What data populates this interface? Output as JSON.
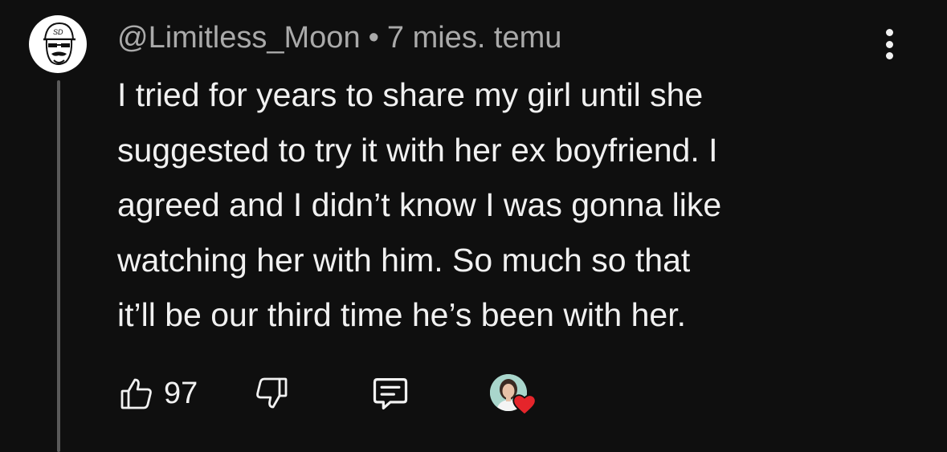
{
  "comment": {
    "author": "@Limitless_Moon",
    "separator": "•",
    "timestamp": "7 mies. temu",
    "lines": [
      "I tried for years to share my girl until she",
      "suggested to try it with her ex boyfriend. I",
      "agreed and I didn’t know I was gonna like",
      "watching her with him. So much so that",
      "it’ll be our third time he’s been with her."
    ]
  },
  "actions": {
    "like_count": "97"
  },
  "icons": {
    "more": "more-vertical-icon",
    "like": "thumbs-up-icon",
    "dislike": "thumbs-down-icon",
    "reply": "reply-comment-icon",
    "creator_heart": "heart-icon"
  },
  "colors": {
    "background": "#0f0f0f",
    "text": "#f1f1f1",
    "muted": "#aaaaaa",
    "heart": "#e5252b"
  }
}
